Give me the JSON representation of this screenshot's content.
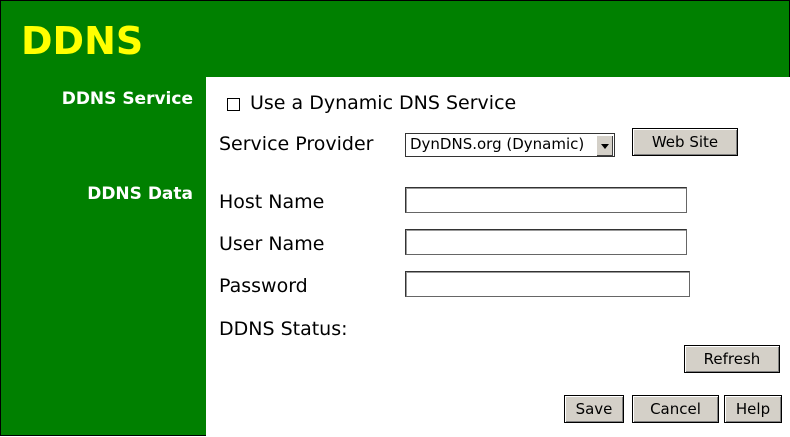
{
  "page": {
    "title": "DDNS"
  },
  "sections": {
    "service_label": "DDNS Service",
    "data_label": "DDNS Data"
  },
  "service": {
    "use_ddns_label": "Use a Dynamic DNS Service",
    "use_ddns_checked": false,
    "provider_label": "Service Provider",
    "provider_selected": "DynDNS.org (Dynamic)",
    "website_button": "Web Site"
  },
  "data": {
    "host_name_label": "Host Name",
    "host_name_value": "",
    "user_name_label": "User Name",
    "user_name_value": "",
    "password_label": "Password",
    "password_value": "",
    "status_label": "DDNS Status:",
    "refresh_button": "Refresh"
  },
  "footer": {
    "save_button": "Save",
    "cancel_button": "Cancel",
    "help_button": "Help"
  },
  "colors": {
    "frame": "#008000",
    "title": "#ffff00",
    "content": "#ffffff",
    "button": "#d4d0c8"
  }
}
